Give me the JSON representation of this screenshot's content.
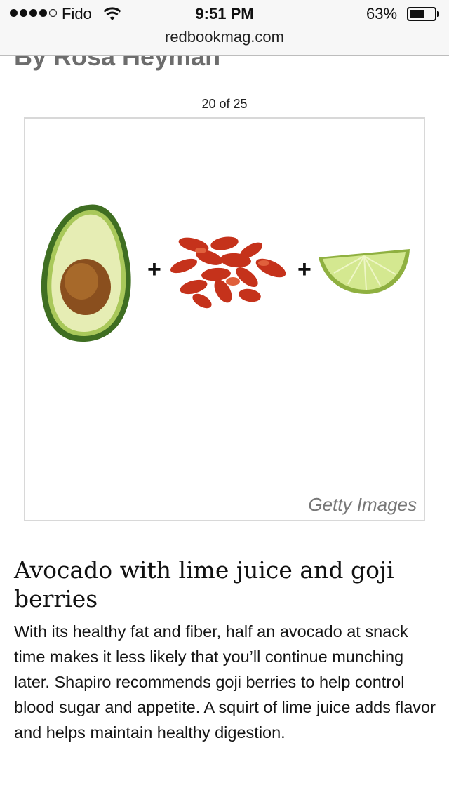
{
  "status_bar": {
    "carrier": "Fido",
    "time": "9:51 PM",
    "battery_percent": "63%",
    "battery_level": 0.63,
    "signal_bars_filled": 4,
    "signal_bars_total": 5
  },
  "browser": {
    "url": "redbookmag.com"
  },
  "article": {
    "byline": "By Rosa Heyman",
    "slide_counter": "20 of 25",
    "image": {
      "credit": "Getty Images",
      "items": [
        "avocado-half",
        "goji-berries",
        "lime-wedge"
      ]
    },
    "headline": "Avocado with lime juice and goji berries",
    "body": "With its healthy fat and fiber, half an avocado at snack time makes it less likely that you’ll continue munching later. Shapiro recommends goji berries to help control blood sugar and appetite. A squirt of lime juice adds flavor and helps maintain healthy digestion."
  },
  "colors": {
    "avocado_skin": "#4a7a2a",
    "avocado_flesh": "#e8efb8",
    "avocado_pit": "#9a5a22",
    "goji": "#c8321c",
    "lime": "#c9e07a"
  }
}
